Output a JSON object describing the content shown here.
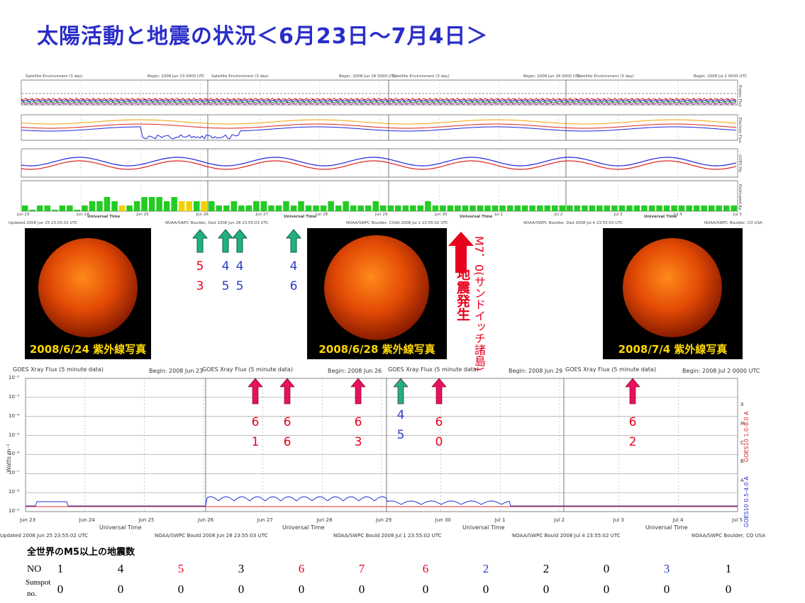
{
  "title": "太陽活動と地震の状況＜6月23日～7月4日＞",
  "satellite_env": {
    "headers": [
      {
        "text": "Satellite Environment (3 day)",
        "begin": "Begin: 2008 Jun 23 0000 UTC"
      },
      {
        "text": "Satellite Environment (3 day)",
        "begin": "Begin: 2008 Jun 26 0000 UTC"
      },
      {
        "text": "Satellite Environment (3 day)",
        "begin": "Begin: 2008 Jul 2 0000 UTC"
      }
    ],
    "side_labels": [
      "Proton Flux",
      "Electron Flux",
      "GOES Hp",
      "Estimated Kp"
    ],
    "x_ticks": [
      "Jun 23",
      "Jun 24",
      "Jun 25",
      "Jun 26",
      "Jun 27",
      "Jun 28",
      "Jun 29",
      "Jun 30",
      "Jul 1",
      "Jul 2",
      "Jul 3",
      "Jul 4",
      "Jul 5"
    ],
    "axis_title": "Universal Time",
    "footers": [
      "Updated 2008 Jun 25 23:55:02 UTC",
      "NOAA/SWPC Boulder, Ded 2008 Jun 28 23:55:03 UTC",
      "NOAA/SWPC Boulder, COdd 2008 Jul 1 23:55:02 UTC",
      "NOAA/SWPC Boulder, Ded 2008 Jul 4 23:55:03 UTC",
      "NOAA/SWPC Boulder, CO USA"
    ],
    "kp_colors": {
      "green": "#22cc22",
      "yellow": "#f0d000"
    }
  },
  "sun_images": [
    {
      "label": "2008/6/24 紫外線写真"
    },
    {
      "label": "2008/6/28 紫外線写真"
    },
    {
      "label": "2008/7/4 紫外線写真"
    }
  ],
  "upper_arrows": [
    {
      "top": "5",
      "bottom": "3",
      "color_top": "#e8001c",
      "color_bottom": "#e8001c"
    },
    {
      "top": "4",
      "bottom": "5",
      "color_top": "#2a3cc8",
      "color_bottom": "#2a3cc8"
    },
    {
      "top": "4",
      "bottom": "5",
      "color_top": "#2a3cc8",
      "color_bottom": "#2a3cc8"
    },
    {
      "top": "4",
      "bottom": "6",
      "color_top": "#2a3cc8",
      "color_bottom": "#2a3cc8"
    }
  ],
  "big_quake": {
    "magnitude": "M7．0(サンドイッチ諸島)",
    "label": "地震発生",
    "color": "#e8001c"
  },
  "xray": {
    "header_text": "GOES Xray Flux (5 minute data)",
    "begins": [
      "Begin: 2008 Jun 23",
      "Begin: 2008 Jun 26",
      "Begin: 2008 Jun 29",
      "Begin: 2008 Jul 2 0000 UTC"
    ],
    "ylabel": "Watts m⁻²",
    "y_ticks": [
      "10⁻²",
      "10⁻³",
      "10⁻⁴",
      "10⁻⁵",
      "10⁻⁶",
      "10⁻⁷",
      "10⁻⁸",
      "10⁻⁹"
    ],
    "class_letters": [
      "X",
      "M",
      "C",
      "B",
      "A"
    ],
    "right_labels": [
      "GOES10 1.0-8.0 A",
      "GOES10 0.5-4.0 A"
    ],
    "x_ticks": [
      "Jun 23",
      "Jun 24",
      "Jun 25",
      "Jun 26",
      "Jun 27",
      "Jun 28",
      "Jun 29",
      "Jun 30",
      "Jul 1",
      "Jul 2",
      "Jul 3",
      "Jul 4",
      "Jul 5"
    ],
    "axis_title": "Universal Time",
    "footers": [
      "Updated 2008 Jun 25 23:55:02 UTC",
      "NOAA/SWPC Bould 2008 Jun 28 23:55:03 UTC",
      "NOAA/SWPC Bould 2008 Jul 1 23:55:02 UTC",
      "NOAA/SWPC Bould 2008 Jul 4 23:55:02 UTC",
      "NOAA/SWPC Boulder, CO USA"
    ]
  },
  "lower_arrows": [
    {
      "top": "6",
      "bottom": "1",
      "color": "#e8001c",
      "arrow": "pink"
    },
    {
      "top": "6",
      "bottom": "6",
      "color": "#e8001c",
      "arrow": "pink"
    },
    {
      "top": "6",
      "bottom": "3",
      "color": "#e8001c",
      "arrow": "pink"
    },
    {
      "top": "4",
      "bottom": "5",
      "color": "#2a3cc8",
      "arrow": "green"
    },
    {
      "top": "6",
      "bottom": "0",
      "color": "#e8001c",
      "arrow": "pink"
    },
    {
      "top": "6",
      "bottom": "2",
      "color": "#e8001c",
      "arrow": "pink"
    }
  ],
  "table": {
    "title": "全世界のM5以上の地震数",
    "no_label": "NO",
    "sunspot_label_1": "Sunspot",
    "sunspot_label_2": "no.",
    "counts": [
      {
        "v": "1",
        "color": "#000000"
      },
      {
        "v": "4",
        "color": "#000000"
      },
      {
        "v": "5",
        "color": "#e8001c"
      },
      {
        "v": "3",
        "color": "#000000"
      },
      {
        "v": "6",
        "color": "#e8001c"
      },
      {
        "v": "7",
        "color": "#e8001c"
      },
      {
        "v": "6",
        "color": "#e8001c"
      },
      {
        "v": "2",
        "color": "#2a3cc8"
      },
      {
        "v": "2",
        "color": "#000000"
      },
      {
        "v": "0",
        "color": "#000000"
      },
      {
        "v": "3",
        "color": "#2a3cc8"
      },
      {
        "v": "1",
        "color": "#000000"
      }
    ],
    "sunspots": [
      "0",
      "0",
      "0",
      "0",
      "0",
      "0",
      "0",
      "0",
      "0",
      "0",
      "0",
      "0"
    ]
  }
}
